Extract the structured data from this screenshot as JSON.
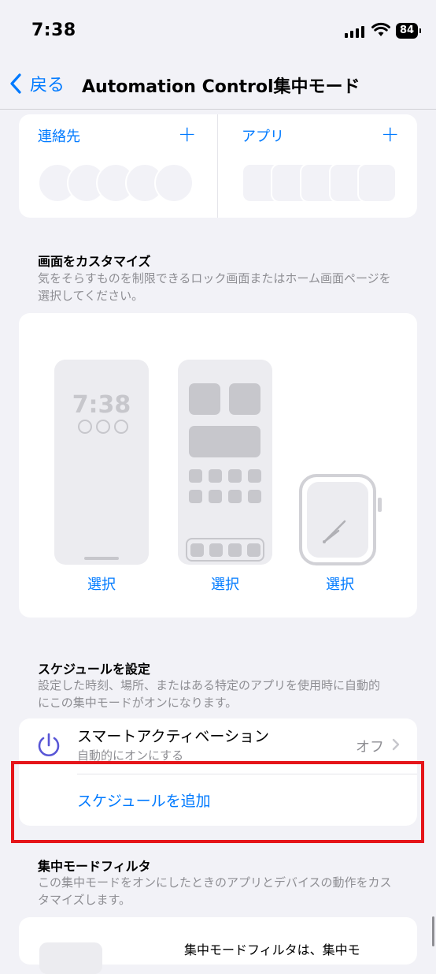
{
  "status": {
    "time": "7:38",
    "battery": "84"
  },
  "nav": {
    "back_label": "戻る",
    "title": "Automation Control集中モード"
  },
  "allowed": {
    "contacts_label": "連絡先",
    "apps_label": "アプリ",
    "add_symbol": "+"
  },
  "customize": {
    "title": "画面をカスタマイズ",
    "description": "気をそらすものを制限できるロック画面またはホーム画面ページを選択してください。",
    "lock_time": "7:38",
    "choose_label": "選択"
  },
  "schedule": {
    "title": "スケジュールを設定",
    "description": "設定した時刻、場所、またはある特定のアプリを使用時に自動的にこの集中モードがオンになります。",
    "smart_title": "スマートアクティベーション",
    "smart_subtitle": "自動的にオンにする",
    "smart_value": "オフ",
    "add_schedule": "スケジュールを追加"
  },
  "filters": {
    "title": "集中モードフィルタ",
    "description": "この集中モードをオンにしたときのアプリとデバイスの動作をカスタマイズします。",
    "card_text": "集中モードフィルタは、集中モ"
  },
  "colors": {
    "accent": "#007aff",
    "highlight": "#e5151a",
    "background": "#f2f2f7"
  }
}
